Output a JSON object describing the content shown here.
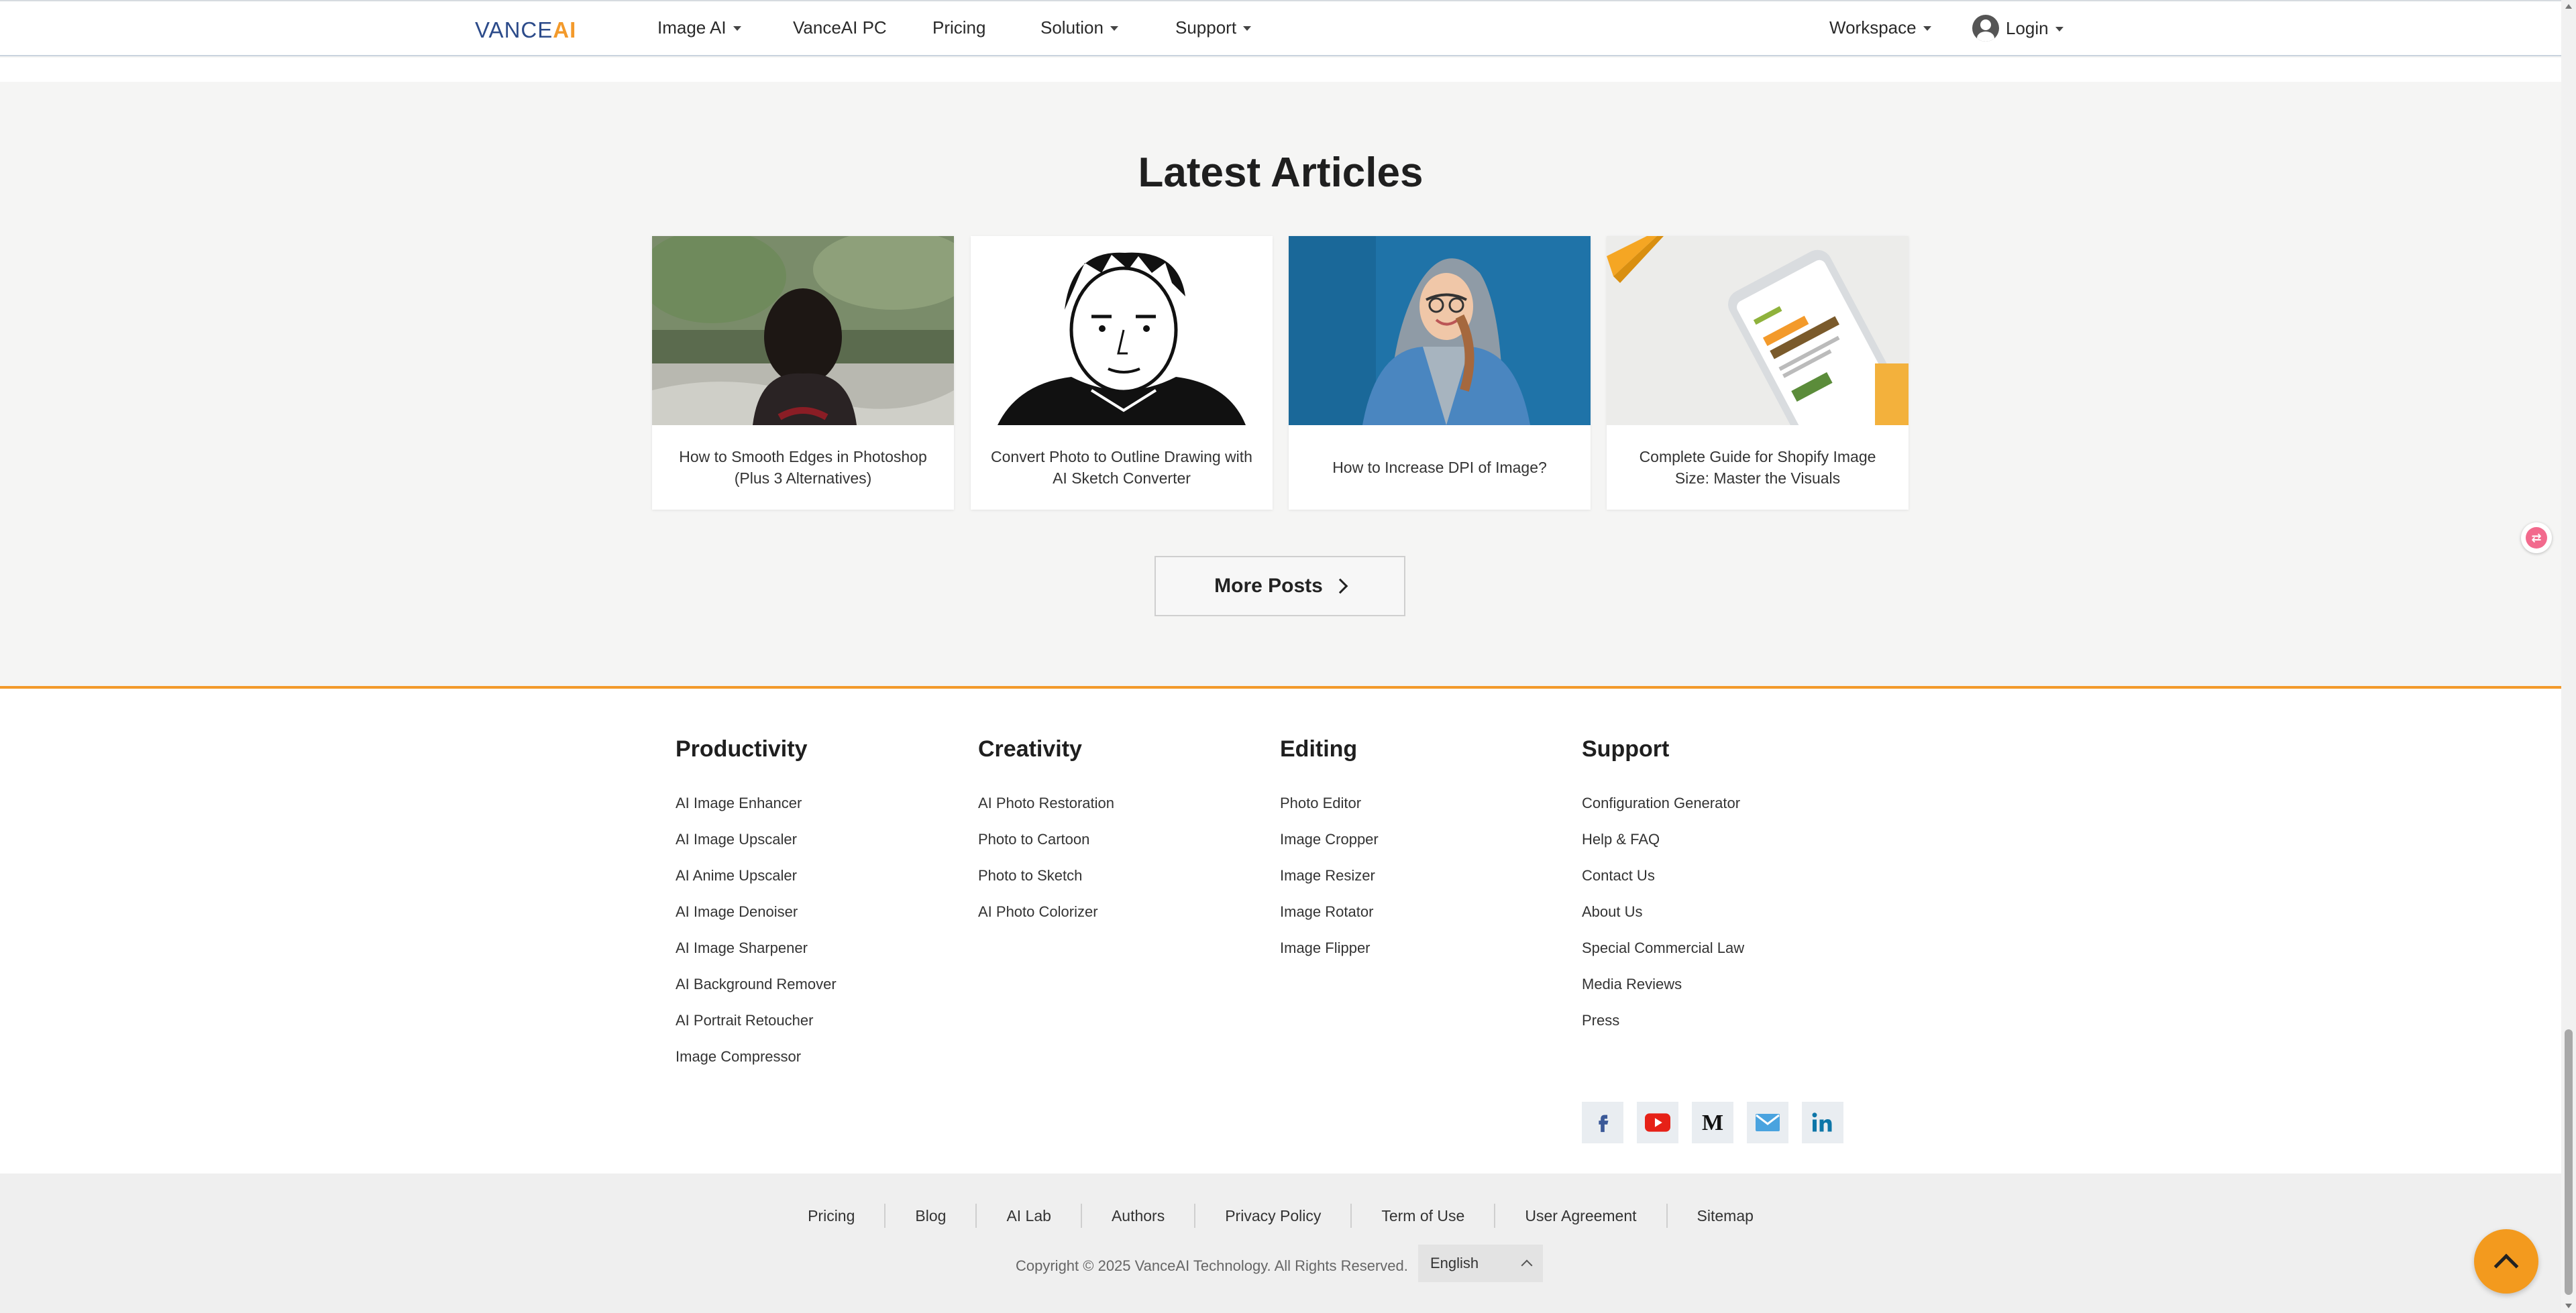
{
  "header": {
    "logo_part1": "VANCE",
    "logo_part2": "AI",
    "nav": [
      {
        "label": "Image AI",
        "dropdown": true
      },
      {
        "label": "VanceAI PC",
        "dropdown": false
      },
      {
        "label": "Pricing",
        "dropdown": false
      },
      {
        "label": "Solution",
        "dropdown": true
      },
      {
        "label": "Support",
        "dropdown": true
      }
    ],
    "workspace_label": "Workspace",
    "login_label": "Login"
  },
  "articles": {
    "title": "Latest Articles",
    "items": [
      {
        "caption": "How to Smooth Edges in Photoshop (Plus 3 Alternatives)"
      },
      {
        "caption": "Convert Photo to Outline Drawing with AI Sketch Converter"
      },
      {
        "caption": "How to Increase DPI of Image?"
      },
      {
        "caption": "Complete Guide for Shopify Image Size: Master the Visuals"
      }
    ],
    "more_label": "More Posts"
  },
  "footer": {
    "columns": [
      {
        "heading": "Productivity",
        "links": [
          "AI Image Enhancer",
          "AI Image Upscaler",
          "AI Anime Upscaler",
          "AI Image Denoiser",
          "AI Image Sharpener",
          "AI Background Remover",
          "AI Portrait Retoucher",
          "Image Compressor"
        ]
      },
      {
        "heading": "Creativity",
        "links": [
          "AI Photo Restoration",
          "Photo to Cartoon",
          "Photo to Sketch",
          "AI Photo Colorizer"
        ]
      },
      {
        "heading": "Editing",
        "links": [
          "Photo Editor",
          "Image Cropper",
          "Image Resizer",
          "Image Rotator",
          "Image Flipper"
        ]
      },
      {
        "heading": "Support",
        "links": [
          "Configuration Generator",
          "Help & FAQ",
          "Contact Us",
          "About Us",
          "Special Commercial Law",
          "Media Reviews",
          "Press"
        ]
      }
    ],
    "social": [
      "facebook-icon",
      "youtube-icon",
      "medium-icon",
      "email-icon",
      "linkedin-icon"
    ],
    "bottom_links": [
      "Pricing",
      "Blog",
      "AI Lab",
      "Authors",
      "Privacy Policy",
      "Term of Use",
      "User Agreement",
      "Sitemap"
    ],
    "copyright": "Copyright © 2025 VanceAI Technology. All Rights Reserved.",
    "language": "English"
  },
  "colors": {
    "brand_blue": "#2c4b8a",
    "brand_orange": "#f39a2b"
  }
}
